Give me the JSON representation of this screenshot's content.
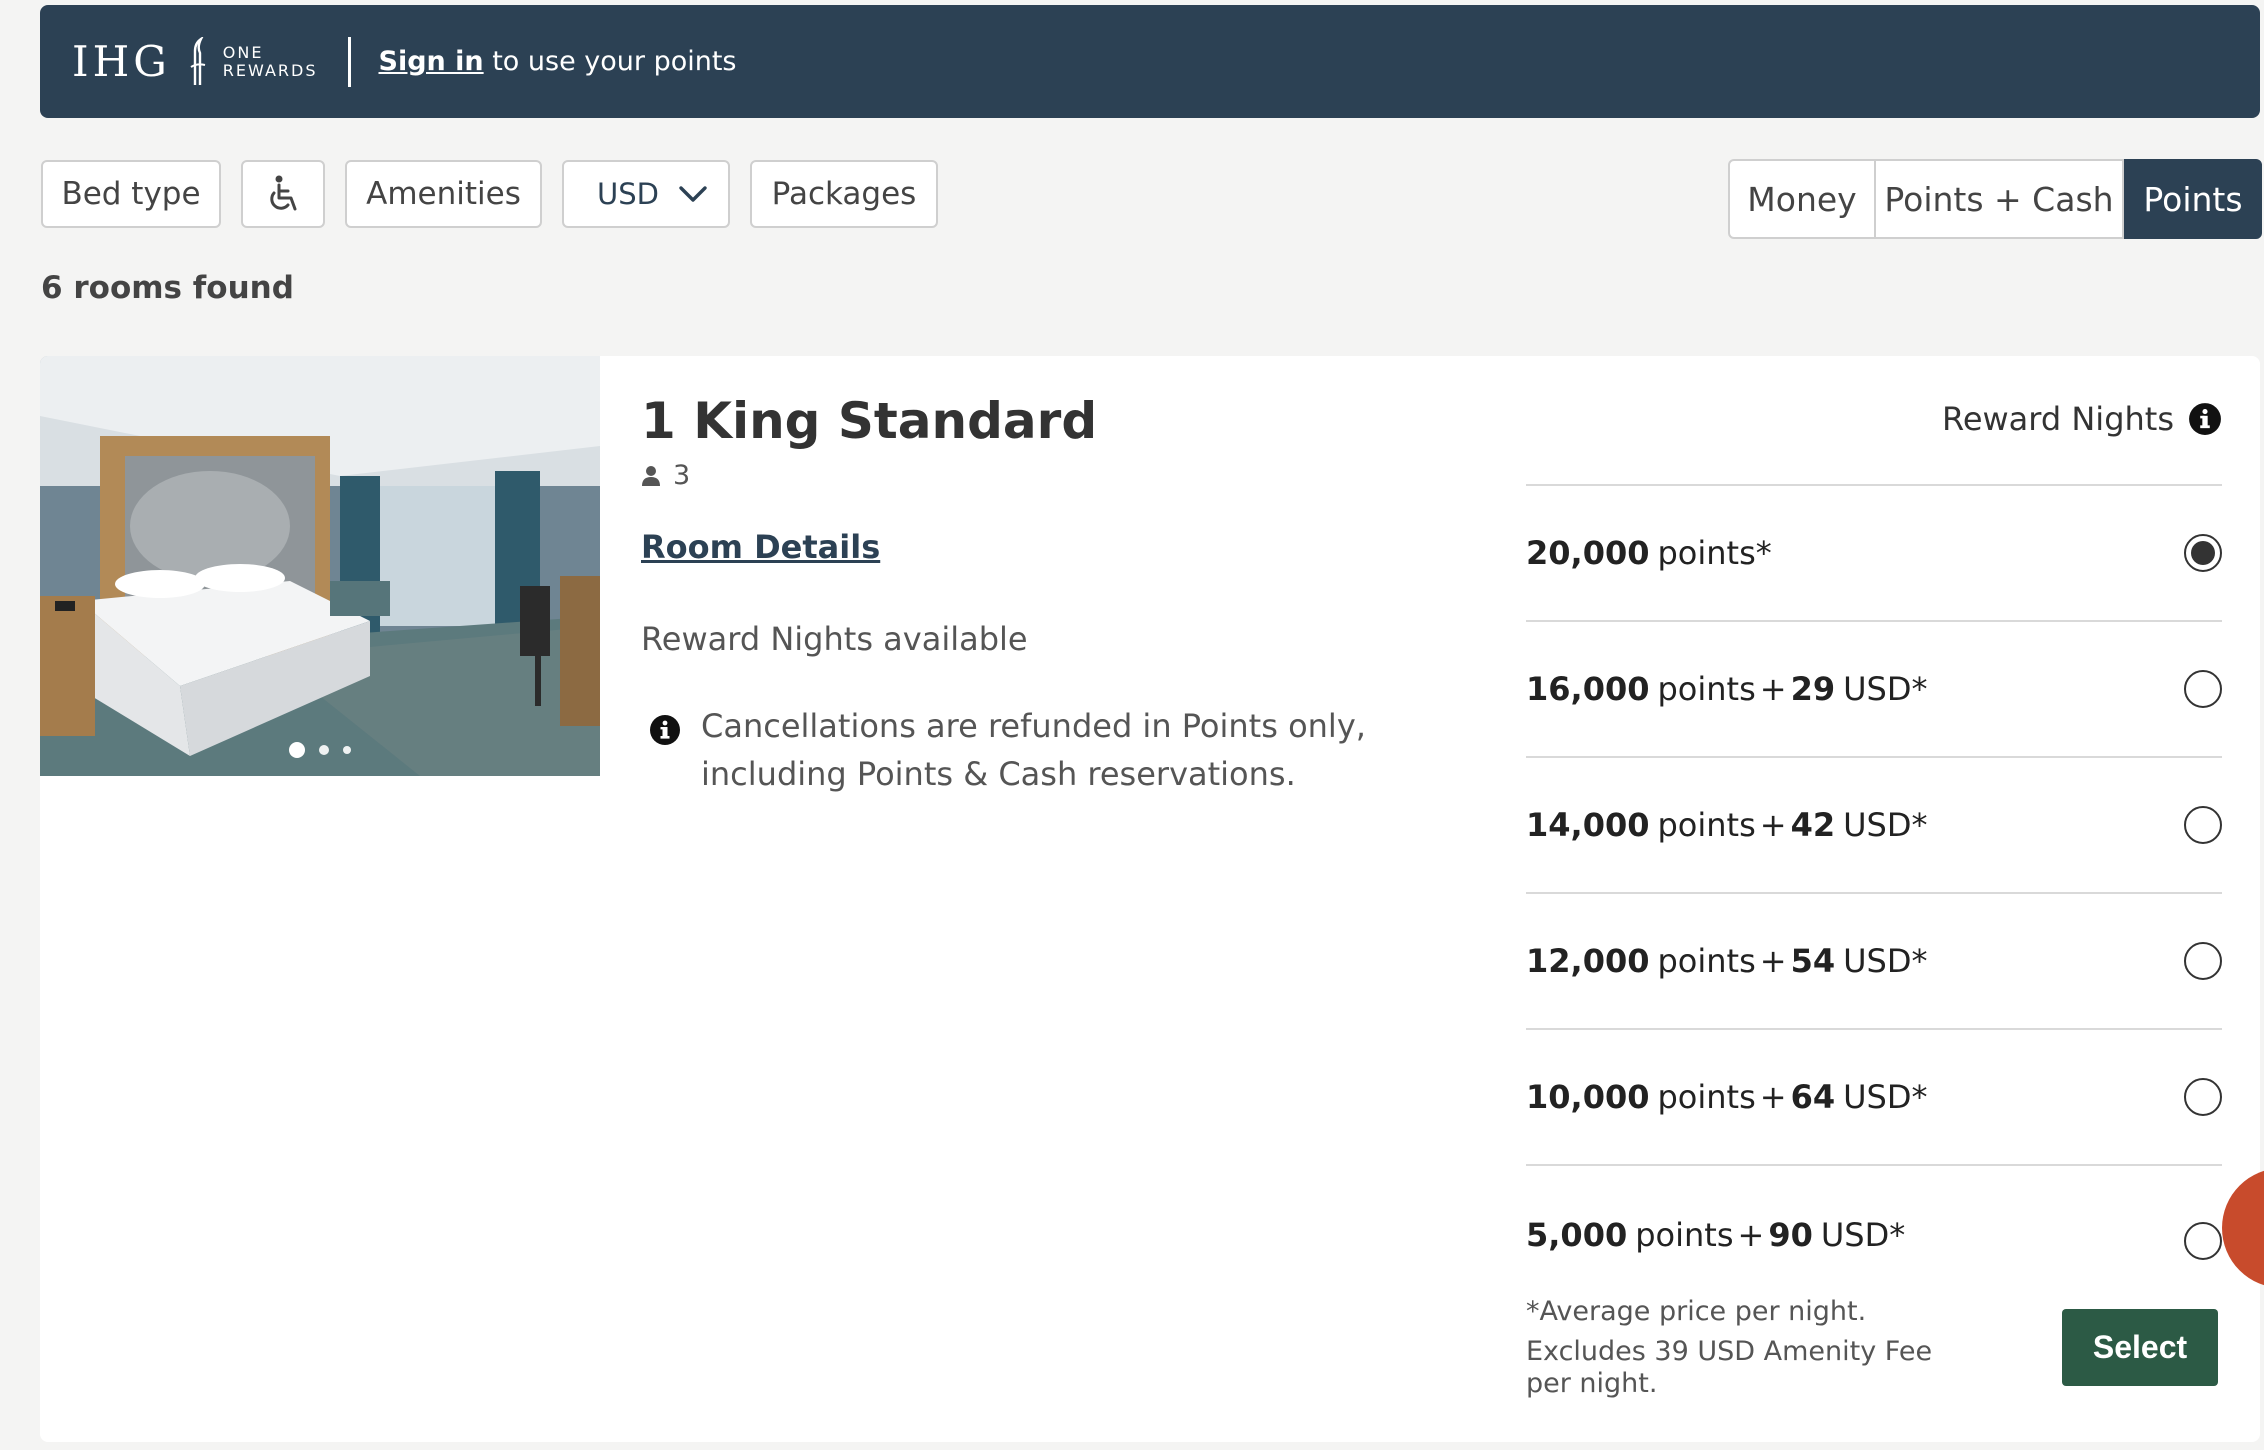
{
  "banner": {
    "logo_main": "IHG",
    "logo_sub_1": "ONE",
    "logo_sub_2": "REWARDS",
    "sign_in_label": "Sign in",
    "sign_in_suffix": " to use your points",
    "bg_color": "#2c4154"
  },
  "filters": {
    "bed_type": "Bed type",
    "accessibility_icon": "wheelchair-icon",
    "amenities": "Amenities",
    "currency": "USD",
    "packages": "Packages"
  },
  "payment_toggle": {
    "options": [
      "Money",
      "Points + Cash",
      "Points"
    ],
    "selected": "Points"
  },
  "results": {
    "count_text": "6 rooms found"
  },
  "room": {
    "name": "1 King Standard",
    "guests": "3",
    "details_link": "Room Details",
    "availability": "Reward Nights available",
    "cancellation_note": "Cancellations are refunded in Points only, including Points & Cash reservations.",
    "photo_dots": 3,
    "photo_active_dot": 1
  },
  "rates": {
    "header": "Reward Nights",
    "options": [
      {
        "points": "20,000",
        "points_label": "points*",
        "cash": "",
        "cash_label": "",
        "selected": true
      },
      {
        "points": "16,000",
        "points_label": "points",
        "cash": "29",
        "cash_label": "USD*",
        "selected": false
      },
      {
        "points": "14,000",
        "points_label": "points",
        "cash": "42",
        "cash_label": "USD*",
        "selected": false
      },
      {
        "points": "12,000",
        "points_label": "points",
        "cash": "54",
        "cash_label": "USD*",
        "selected": false
      },
      {
        "points": "10,000",
        "points_label": "points",
        "cash": "64",
        "cash_label": "USD*",
        "selected": false
      },
      {
        "points": "5,000",
        "points_label": "points",
        "cash": "90",
        "cash_label": "USD*",
        "selected": false
      }
    ],
    "footnote_1": "*Average price per night.",
    "footnote_2": "Excludes 39 USD Amenity Fee per night.",
    "select_label": "Select",
    "select_color": "#2c5a45"
  }
}
